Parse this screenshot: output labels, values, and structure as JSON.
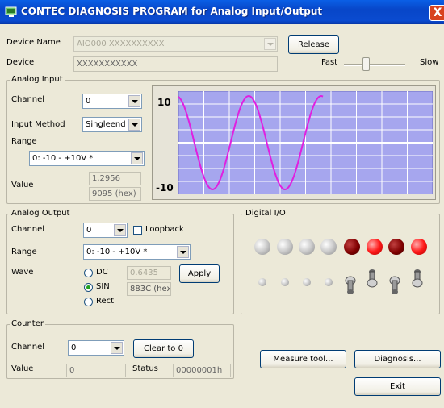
{
  "window": {
    "title": "CONTEC DIAGNOSIS PROGRAM for Analog Input/Output",
    "close": "X"
  },
  "device": {
    "name_label": "Device Name",
    "name_value": "AIO000 XXXXXXXXXX",
    "release_button": "Release",
    "device_label": "Device",
    "device_value": "XXXXXXXXXXX",
    "speed_fast": "Fast",
    "speed_slow": "Slow",
    "speed_level": 0.3
  },
  "analog_input": {
    "title": "Analog Input",
    "channel_label": "Channel",
    "channel_value": "0",
    "input_method_label": "Input Method",
    "input_method_value": "Singleend",
    "range_label": "Range",
    "range_value": "0: -10 - +10V *",
    "value_label": "Value",
    "value": "1.2956",
    "value_hex": "9095 (hex)",
    "graph_max_label": "10",
    "graph_min_label": "-10",
    "graph_bg": "#a6a6ee",
    "graph_line": "#e020e0"
  },
  "analog_output": {
    "title": "Analog Output",
    "channel_label": "Channel",
    "channel_value": "0",
    "loopback_label": "Loopback",
    "range_label": "Range",
    "range_value": "0: -10 - +10V *",
    "wave_label": "Wave",
    "wave_dc": "DC",
    "wave_sin": "SIN",
    "wave_rect": "Rect",
    "selected_wave": "SIN",
    "dc_value": "0.6435",
    "sin_hex": "883C (hex)",
    "apply_button": "Apply"
  },
  "digital_io": {
    "title": "Digital I/O",
    "outputs": [
      "off",
      "off",
      "off",
      "off",
      "dark",
      "on",
      "dark",
      "on"
    ],
    "inputs": [
      "dot",
      "dot",
      "dot",
      "dot",
      "switch-down",
      "switch-up",
      "switch-down",
      "switch-up"
    ]
  },
  "counter": {
    "title": "Counter",
    "channel_label": "Channel",
    "channel_value": "0",
    "clear_button": "Clear to 0",
    "value_label": "Value",
    "value": "0",
    "status_label": "Status",
    "status_value": "00000001h"
  },
  "buttons": {
    "measure": "Measure tool...",
    "diagnosis": "Diagnosis...",
    "exit": "Exit"
  }
}
